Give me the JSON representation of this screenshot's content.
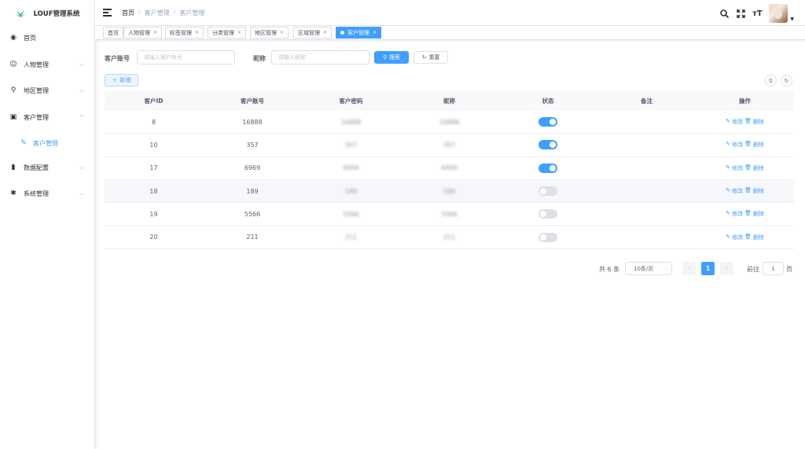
{
  "app": {
    "title": "LOUF管理系统"
  },
  "sidebar": {
    "items": [
      {
        "label": "首页",
        "icon": "dashboard-icon",
        "glyph": "◉"
      },
      {
        "label": "人物管理",
        "icon": "person-icon",
        "glyph": "☺"
      },
      {
        "label": "地区管理",
        "icon": "tree-icon",
        "glyph": "⚲"
      },
      {
        "label": "客户管理",
        "icon": "user-card-icon",
        "glyph": "▣"
      },
      {
        "label": "客户管理",
        "icon": "user-icon",
        "glyph": "✎"
      },
      {
        "label": "数据配置",
        "icon": "chart-icon",
        "glyph": "▮"
      },
      {
        "label": "系统管理",
        "icon": "gear-icon",
        "glyph": "✱"
      }
    ]
  },
  "header": {
    "breadcrumb": [
      "首页",
      "客户管理",
      "客户管理"
    ],
    "sep": "/",
    "icons": [
      "search-icon",
      "fullscreen-icon",
      "font-size-icon"
    ],
    "font_glyph": "тT"
  },
  "tags": [
    {
      "label": "首页",
      "closable": false
    },
    {
      "label": "人物管理",
      "closable": true
    },
    {
      "label": "标签管理",
      "closable": true
    },
    {
      "label": "分类管理",
      "closable": true
    },
    {
      "label": "地区管理",
      "closable": true
    },
    {
      "label": "区域管理",
      "closable": true
    },
    {
      "label": "客户管理",
      "closable": true,
      "active": true
    }
  ],
  "search": {
    "account_label": "客户账号",
    "account_placeholder": "请输入客户账号",
    "nickname_label": "昵称",
    "nickname_placeholder": "请输入昵称",
    "search_button": "搜索",
    "reset_button": "重置"
  },
  "toolbar": {
    "add_button": "新增"
  },
  "table": {
    "columns": [
      "客户ID",
      "客户账号",
      "客户密码",
      "昵称",
      "状态",
      "备注",
      "操作"
    ],
    "rows": [
      {
        "id": "8",
        "account": "16888",
        "password": "16888",
        "nickname": "16888",
        "status": true,
        "note": ""
      },
      {
        "id": "10",
        "account": "357",
        "password": "357",
        "nickname": "357",
        "status": true,
        "note": ""
      },
      {
        "id": "17",
        "account": "6969",
        "password": "6969",
        "nickname": "6969",
        "status": true,
        "note": ""
      },
      {
        "id": "18",
        "account": "189",
        "password": "189",
        "nickname": "189",
        "status": false,
        "note": ""
      },
      {
        "id": "19",
        "account": "5566",
        "password": "5566",
        "nickname": "5566",
        "status": false,
        "note": ""
      },
      {
        "id": "20",
        "account": "211",
        "password": "211",
        "nickname": "211",
        "status": false,
        "note": ""
      }
    ],
    "edit_label": "修改",
    "delete_label": "删除"
  },
  "pagination": {
    "total_text": "共 6 条",
    "page_size": "10条/页",
    "current_page": "1",
    "goto_prefix": "前往",
    "goto_value": "1",
    "goto_suffix": "页"
  },
  "colors": {
    "primary": "#409eff",
    "text": "#606266",
    "border": "#dcdfe6"
  }
}
